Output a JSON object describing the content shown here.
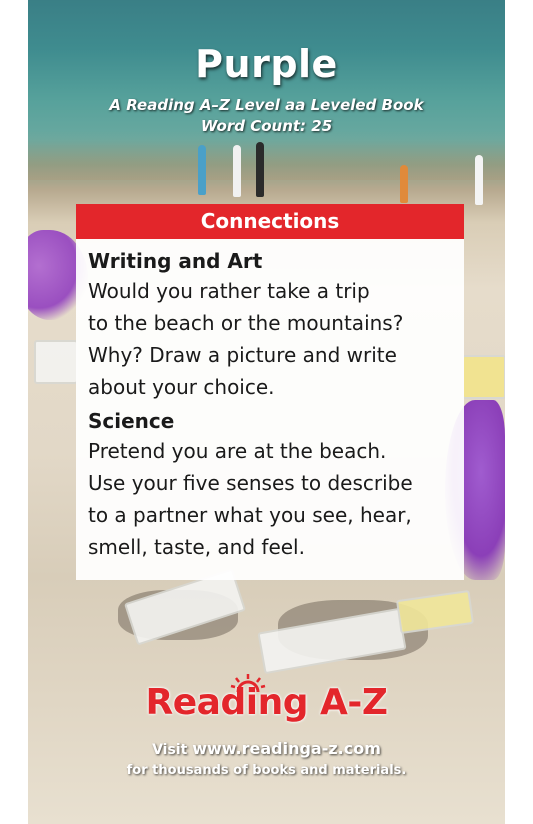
{
  "cover": {
    "title": "Purple",
    "subtitle_line1": "A Reading A–Z Level aa Leveled Book",
    "subtitle_line2": "Word Count: 25"
  },
  "connections": {
    "header": "Connections",
    "sections": [
      {
        "heading": "Writing and Art",
        "lines": [
          "Would you rather take a trip",
          "to the beach or the mountains?",
          "Why? Draw a picture and write",
          "about your choice."
        ]
      },
      {
        "heading": "Science",
        "lines": [
          "Pretend you are at the beach.",
          "Use your five senses to describe",
          "to a partner what you see, hear,",
          "smell, taste, and feel."
        ]
      }
    ]
  },
  "footer": {
    "logo": "Reading A-Z",
    "visit_prefix": "Visit ",
    "url": "www.readinga-z.com",
    "tagline": "for thousands of books and materials."
  },
  "colors": {
    "brand_red": "#e3262b",
    "umbrella_purple": "#9a4fc0"
  }
}
